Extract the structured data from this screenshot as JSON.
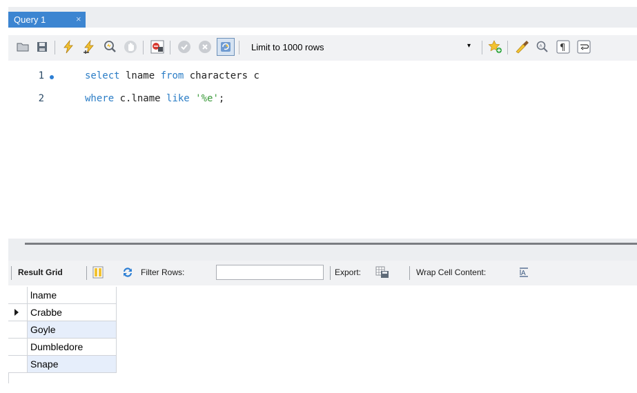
{
  "tab": {
    "title": "Query 1",
    "close_glyph": "×"
  },
  "toolbar": {
    "buttons": [
      "open-folder-icon",
      "save-icon",
      "execute-icon",
      "execute-current-icon",
      "explain-icon",
      "stop-icon",
      "toggle-stop-on-error-icon",
      "commit-icon",
      "rollback-icon",
      "autocommit-icon"
    ],
    "limit_label": "Limit to 1000 rows",
    "limit_caret": "▾",
    "right_buttons": [
      "add-snippet-icon",
      "beautify-icon",
      "find-icon",
      "invisible-chars-icon",
      "wrap-lines-icon"
    ]
  },
  "editor": {
    "lines": [
      {
        "num": "1",
        "has_dot": true
      },
      {
        "num": "2",
        "has_dot": false
      }
    ],
    "line1": {
      "kw1": "select",
      "t1": " lname ",
      "kw2": "from",
      "t2": " characters c"
    },
    "line2": {
      "kw1": "where",
      "t1": " c.lname ",
      "kw2": "like",
      "t2": " ",
      "str": "'%e'",
      "t3": ";"
    }
  },
  "results": {
    "result_grid_label": "Result Grid",
    "filter_label": "Filter Rows:",
    "filter_value": "",
    "export_label": "Export:",
    "wrap_label": "Wrap Cell Content:",
    "columns": [
      "lname"
    ],
    "rows": [
      "Crabbe",
      "Goyle",
      "Dumbledore",
      "Snape"
    ],
    "selected_row": 0
  },
  "colors": {
    "tab_bg": "#3c85d1",
    "keyword": "#2b7dc6",
    "string": "#3a9a3a",
    "row_alt": "#e6eefb"
  }
}
